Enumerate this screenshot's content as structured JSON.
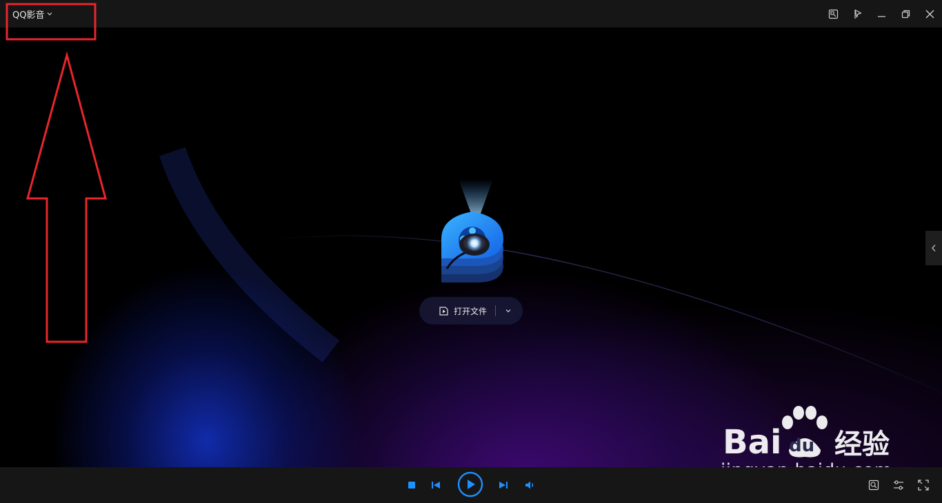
{
  "titlebar": {
    "app_name": "QQ影音",
    "icons": [
      "screenshot-icon",
      "pin-icon",
      "minimize-icon",
      "restore-icon",
      "close-icon"
    ]
  },
  "stage": {
    "open_file_label": "打开文件",
    "icons": [
      "play-file-icon",
      "chevron-down-icon",
      "chevron-left-icon"
    ]
  },
  "controls": {
    "icons": [
      "stop-icon",
      "previous-icon",
      "play-icon",
      "next-icon",
      "volume-icon",
      "screenshot-ai-icon",
      "settings-icon",
      "fullscreen-icon"
    ]
  },
  "watermark": {
    "brand": "经验",
    "url": "jingyan.baidu.com"
  },
  "colors": {
    "accent": "#1e90ff",
    "annotation": "#e8262b",
    "bar_bg": "#161616"
  }
}
